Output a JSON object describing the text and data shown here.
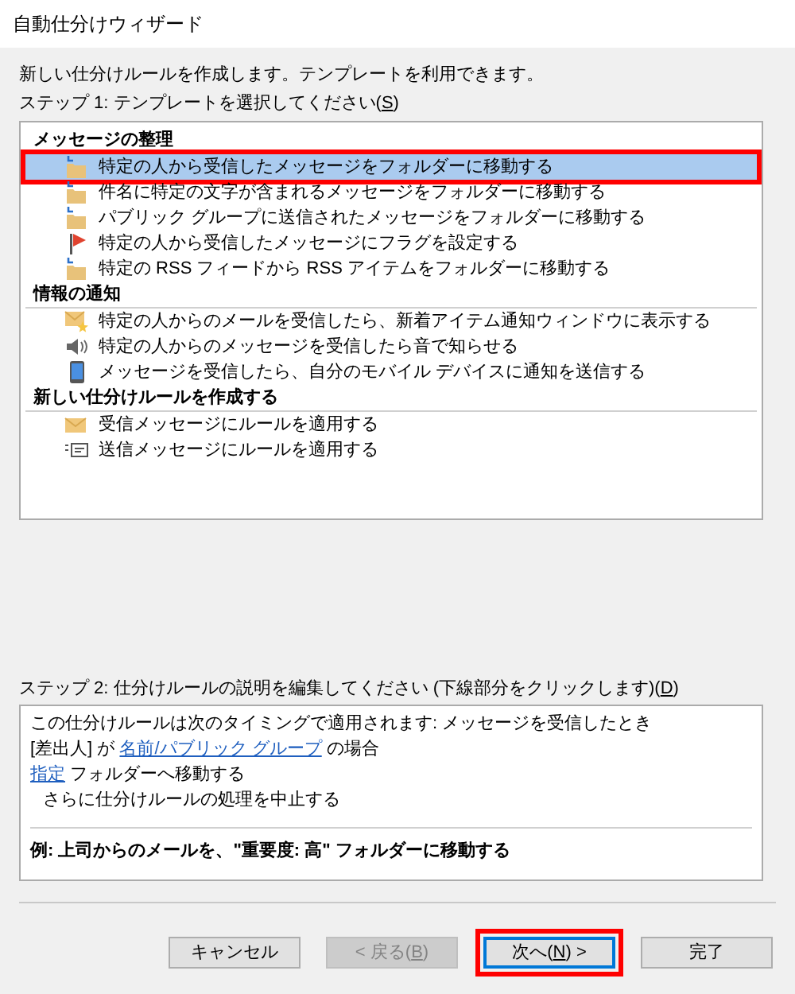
{
  "window": {
    "title": "自動仕分けウィザード"
  },
  "intro": "新しい仕分けルールを作成します。テンプレートを利用できます。",
  "step1": {
    "before": "ステップ 1: テンプレートを選択してください(",
    "key": "S",
    "after": ")"
  },
  "template_groups": [
    {
      "title": "メッセージの整理",
      "items": [
        {
          "kind": "folder",
          "label": "特定の人から受信したメッセージをフォルダーに移動する",
          "selected": true,
          "highlighted": true
        },
        {
          "kind": "folder",
          "label": "件名に特定の文字が含まれるメッセージをフォルダーに移動する",
          "selected": false,
          "highlighted": false
        },
        {
          "kind": "folder",
          "label": "パブリック グループに送信されたメッセージをフォルダーに移動する",
          "selected": false,
          "highlighted": false
        },
        {
          "kind": "flag",
          "label": "特定の人から受信したメッセージにフラグを設定する",
          "selected": false,
          "highlighted": false
        },
        {
          "kind": "folder",
          "label": "特定の RSS フィードから RSS アイテムをフォルダーに移動する",
          "selected": false,
          "highlighted": false
        }
      ]
    },
    {
      "title": "情報の通知",
      "items": [
        {
          "kind": "alert",
          "label": "特定の人からのメールを受信したら、新着アイテム通知ウィンドウに表示する",
          "selected": false,
          "highlighted": false
        },
        {
          "kind": "sound",
          "label": "特定の人からのメッセージを受信したら音で知らせる",
          "selected": false,
          "highlighted": false
        },
        {
          "kind": "mobile",
          "label": "メッセージを受信したら、自分のモバイル デバイスに通知を送信する",
          "selected": false,
          "highlighted": false
        }
      ]
    },
    {
      "title": "新しい仕分けルールを作成する",
      "items": [
        {
          "kind": "received",
          "label": "受信メッセージにルールを適用する",
          "selected": false,
          "highlighted": false
        },
        {
          "kind": "sent",
          "label": "送信メッセージにルールを適用する",
          "selected": false,
          "highlighted": false
        }
      ]
    }
  ],
  "step2": {
    "before": "ステップ 2: 仕分けルールの説明を編集してください (下線部分をクリックします)(",
    "key": "D",
    "after": ")"
  },
  "description": [
    {
      "indent": false,
      "segments": [
        {
          "kind": "text",
          "text": "この仕分けルールは次のタイミングで適用されます: メッセージを受信したとき"
        }
      ]
    },
    {
      "indent": false,
      "segments": [
        {
          "kind": "text",
          "text": "[差出人] が "
        },
        {
          "kind": "link",
          "text": "名前/パブリック グループ"
        },
        {
          "kind": "text",
          "text": " の場合"
        }
      ]
    },
    {
      "indent": false,
      "segments": [
        {
          "kind": "link",
          "text": "指定"
        },
        {
          "kind": "text",
          "text": " フォルダーへ移動する"
        }
      ]
    },
    {
      "indent": true,
      "segments": [
        {
          "kind": "text",
          "text": "さらに仕分けルールの処理を中止する"
        }
      ]
    }
  ],
  "example": "例: 上司からのメールを、\"重要度: 高\" フォルダーに移動する",
  "buttons": [
    {
      "before": "キャンセル",
      "disabled": false,
      "default": false,
      "highlighted": false
    },
    {
      "before": "< 戻る(",
      "key": "B",
      "after": ")",
      "disabled": true,
      "default": false,
      "highlighted": false
    },
    {
      "before": "次へ(",
      "key": "N",
      "after": ") >",
      "disabled": false,
      "default": true,
      "highlighted": true
    },
    {
      "before": "完了",
      "disabled": false,
      "default": false,
      "highlighted": false
    }
  ]
}
